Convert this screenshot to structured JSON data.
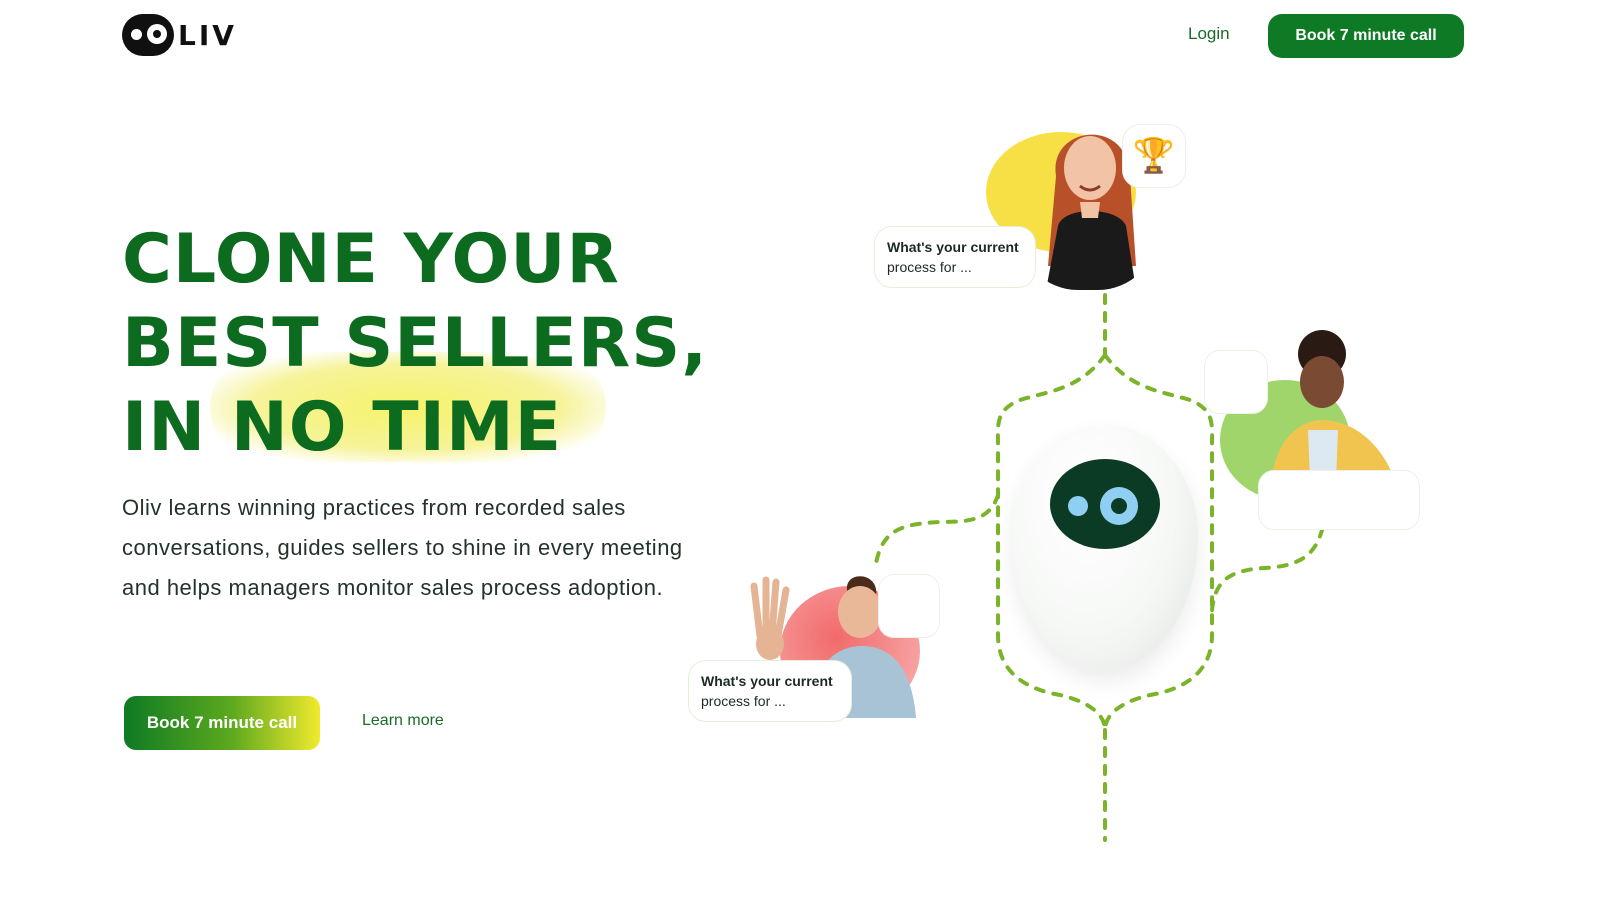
{
  "header": {
    "logo_text": "LIV",
    "login_label": "Login",
    "cta_label": "Book 7 minute call"
  },
  "hero": {
    "headline_lines": [
      "CLONE YOUR",
      "BEST SELLERS,",
      "IN NO TIME"
    ],
    "description": "Oliv learns winning practices from recorded sales conversations, guides sellers to shine in every meeting and helps managers monitor sales process adoption.",
    "primary_cta": "Book 7 minute call",
    "secondary_cta": "Learn more"
  },
  "illustration": {
    "chat_top": {
      "line1": "What's your current",
      "line2": "process for ..."
    },
    "chat_bottom": {
      "line1": "What's your current",
      "line2": "process for ..."
    },
    "trophy_icon": "trophy-icon",
    "colors": {
      "brand_green": "#0f7a26",
      "path_green": "#7bb42a",
      "yellow_blob": "#f7e045",
      "pink_blob": "#f38a8a",
      "light_green_blob": "#9fd56a",
      "robot_face": "#0b3b24",
      "robot_eyes": "#8fd0f2"
    }
  }
}
